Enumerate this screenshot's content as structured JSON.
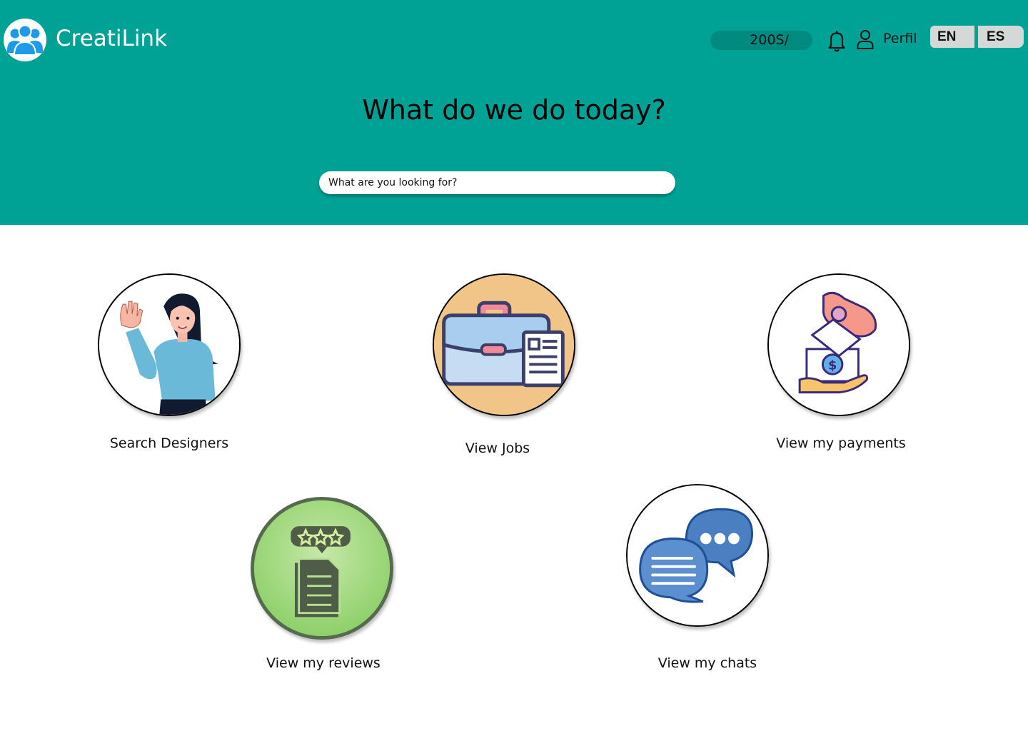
{
  "header": {
    "brand": "CreatiLink",
    "balance": "200S/",
    "profile_label": "Perfil",
    "languages": [
      "EN",
      "ES"
    ]
  },
  "hero": {
    "title": "What do we do today?",
    "search_placeholder": "What are you looking for?"
  },
  "actions": [
    {
      "label": "Search Designers",
      "icon": "designer-waving-icon"
    },
    {
      "label": "View Jobs",
      "icon": "briefcase-icon"
    },
    {
      "label": "View my payments",
      "icon": "payment-hand-icon"
    },
    {
      "label": "View my reviews",
      "icon": "review-document-icon"
    },
    {
      "label": "View my chats",
      "icon": "chat-bubbles-icon"
    }
  ],
  "colors": {
    "header_bg": "#00a295",
    "balance_pill": "#008a80",
    "lang_button": "#d4d9d8",
    "logo_blue": "#1d9be8"
  }
}
